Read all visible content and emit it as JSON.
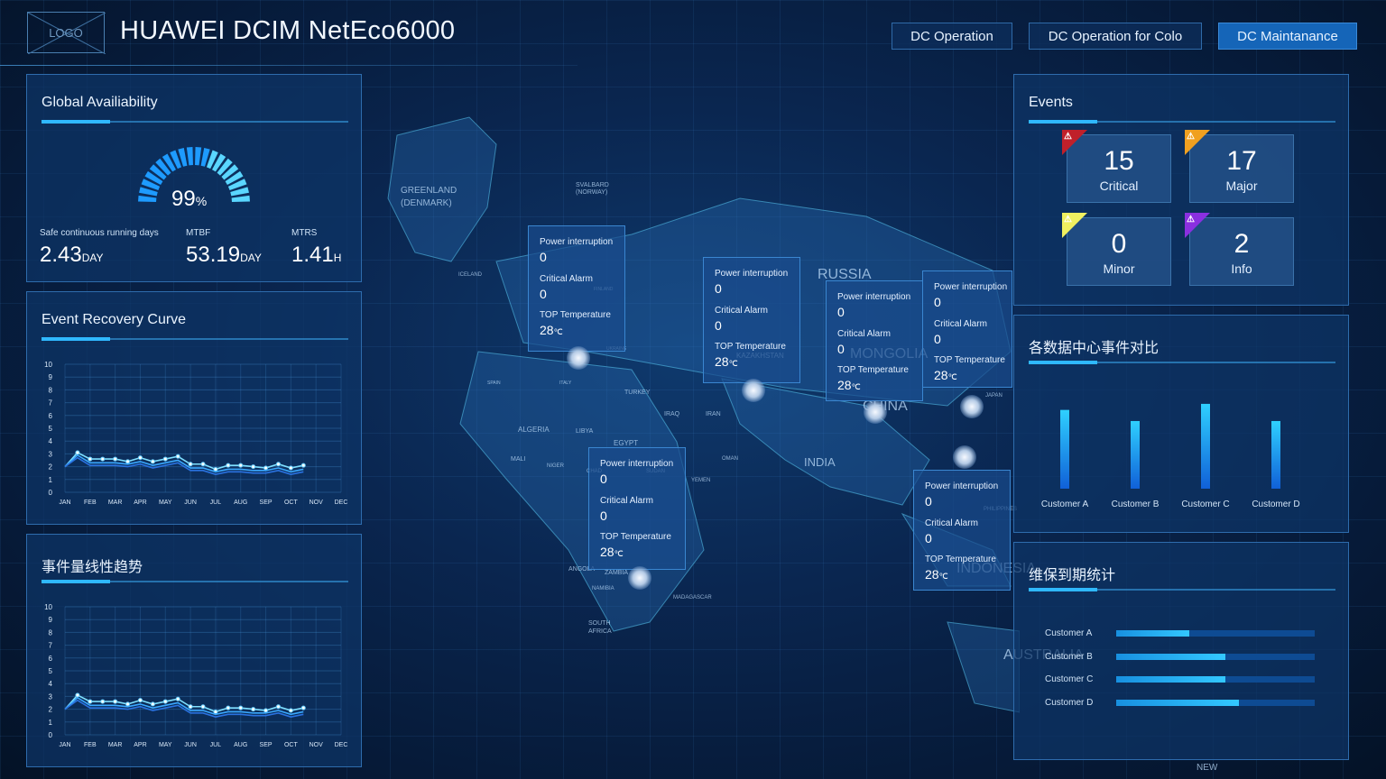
{
  "header": {
    "logo_text": "LOGO",
    "title": "HUAWEI DCIM NetEco6000",
    "nav": [
      {
        "label": "DC Operation",
        "active": false
      },
      {
        "label": "DC Operation for Colo",
        "active": false
      },
      {
        "label": "DC Maintanance",
        "active": true
      }
    ]
  },
  "availability": {
    "title": "Global Availiability",
    "gauge_value": "99",
    "gauge_unit": "%",
    "metrics": [
      {
        "label": "Safe continuous running  days",
        "value": "2.43",
        "unit": "DAY"
      },
      {
        "label": "MTBF",
        "value": "53.19",
        "unit": "DAY"
      },
      {
        "label": "MTRS",
        "value": "1.41",
        "unit": "H"
      }
    ]
  },
  "recovery_curve": {
    "title": "Event Recovery Curve"
  },
  "trend": {
    "title": "事件量线性趋势"
  },
  "events": {
    "title": "Events",
    "items": [
      {
        "count": "15",
        "label": "Critical",
        "color": "#c0202a"
      },
      {
        "count": "17",
        "label": "Major",
        "color": "#f0a020"
      },
      {
        "count": "0",
        "label": "Minor",
        "color": "#f0f060"
      },
      {
        "count": "2",
        "label": "Info",
        "color": "#8a30e0"
      }
    ]
  },
  "dc_compare": {
    "title": "各数据中心事件对比"
  },
  "maintenance": {
    "title": "维保到期统计",
    "items": [
      {
        "label": "Customer A",
        "fraction": 0.37
      },
      {
        "label": "Customer B",
        "fraction": 0.55
      },
      {
        "label": "Customer C",
        "fraction": 0.55
      },
      {
        "label": "Customer D",
        "fraction": 0.62
      }
    ]
  },
  "map": {
    "labels": [
      "GREENLAND",
      "(DENMARK)",
      "SVALBARD",
      "(NORWAY)",
      "RUSSIA",
      "MONGOLIA",
      "CHINA",
      "INDIA",
      "TURKEY",
      "IRAN",
      "IRAQ",
      "EGYPT",
      "LIBYA",
      "ALGERIA",
      "MALI",
      "NIGER",
      "CHAD",
      "SUDAN",
      "OMAN",
      "YEMEN",
      "ANGOLA",
      "ZAMBIA",
      "NAMIBIA",
      "SOUTH",
      "AFRICA",
      "MADAGASCAR",
      "KAZAKHSTAN",
      "UKRAINE",
      "SPAIN",
      "ITALY",
      "FINLAND",
      "ICELAND",
      "JAPAN",
      "PHILIPPINES",
      "INDONESIA",
      "AUSTRALIA",
      "NEW"
    ],
    "popup_labels": {
      "power": "Power interruption",
      "alarm": "Critical Alarm",
      "temp": "TOP Temperature",
      "temp_unit": "℃"
    },
    "popups": [
      {
        "power": "0",
        "alarm": "0",
        "temp": "28"
      },
      {
        "power": "0",
        "alarm": "0",
        "temp": "28"
      },
      {
        "power": "0",
        "alarm": "0",
        "temp": "28"
      },
      {
        "power": "0",
        "alarm": "0",
        "temp": "28"
      },
      {
        "power": "0",
        "alarm": "0",
        "temp": "28"
      },
      {
        "power": "0",
        "alarm": "0",
        "temp": "28"
      }
    ]
  },
  "chart_data": [
    {
      "type": "line",
      "title": "Event Recovery Curve",
      "categories": [
        "JAN",
        "FEB",
        "MAR",
        "APR",
        "MAY",
        "JUN",
        "JUL",
        "AUG",
        "SEP",
        "OCT",
        "NOV",
        "DEC"
      ],
      "x": [
        0,
        0.5,
        1,
        1.5,
        2,
        2.5,
        3,
        3.5,
        4,
        4.5,
        5,
        5.5,
        6,
        6.5,
        7,
        7.5,
        8,
        8.5,
        9,
        9.5
      ],
      "series": [
        {
          "values": [
            2.0,
            3.1,
            2.6,
            2.6,
            2.6,
            2.4,
            2.7,
            2.4,
            2.6,
            2.8,
            2.2,
            2.2,
            1.8,
            2.1,
            2.1,
            2.0,
            1.9,
            2.2,
            1.9,
            2.1
          ]
        },
        {
          "values": [
            2.0,
            2.9,
            2.3,
            2.3,
            2.3,
            2.2,
            2.4,
            2.1,
            2.3,
            2.5,
            1.9,
            1.9,
            1.6,
            1.8,
            1.8,
            1.7,
            1.7,
            1.9,
            1.6,
            1.8
          ]
        },
        {
          "values": [
            2.0,
            2.7,
            2.1,
            2.1,
            2.1,
            2.0,
            2.2,
            1.9,
            2.1,
            2.3,
            1.7,
            1.7,
            1.4,
            1.6,
            1.6,
            1.5,
            1.5,
            1.7,
            1.4,
            1.6
          ]
        }
      ],
      "yticks": [
        0,
        1,
        2,
        3,
        4,
        5,
        6,
        7,
        8,
        9,
        10
      ],
      "ylim": [
        0,
        10
      ],
      "grid": true
    },
    {
      "type": "line",
      "title": "事件量线性趋势",
      "categories": [
        "JAN",
        "FEB",
        "MAR",
        "APR",
        "MAY",
        "JUN",
        "JUL",
        "AUG",
        "SEP",
        "OCT",
        "NOV",
        "DEC"
      ],
      "x": [
        0,
        0.5,
        1,
        1.5,
        2,
        2.5,
        3,
        3.5,
        4,
        4.5,
        5,
        5.5,
        6,
        6.5,
        7,
        7.5,
        8,
        8.5,
        9,
        9.5
      ],
      "series": [
        {
          "values": [
            2.0,
            3.1,
            2.6,
            2.6,
            2.6,
            2.4,
            2.7,
            2.4,
            2.6,
            2.8,
            2.2,
            2.2,
            1.8,
            2.1,
            2.1,
            2.0,
            1.9,
            2.2,
            1.9,
            2.1
          ]
        },
        {
          "values": [
            2.0,
            2.9,
            2.3,
            2.3,
            2.3,
            2.2,
            2.4,
            2.1,
            2.3,
            2.5,
            1.9,
            1.9,
            1.6,
            1.8,
            1.8,
            1.7,
            1.7,
            1.9,
            1.6,
            1.8
          ]
        },
        {
          "values": [
            2.0,
            2.7,
            2.1,
            2.1,
            2.1,
            2.0,
            2.2,
            1.9,
            2.1,
            2.3,
            1.7,
            1.7,
            1.4,
            1.6,
            1.6,
            1.5,
            1.5,
            1.7,
            1.4,
            1.6
          ]
        }
      ],
      "yticks": [
        0,
        1,
        2,
        3,
        4,
        5,
        6,
        7,
        8,
        9,
        10
      ],
      "ylim": [
        0,
        10
      ],
      "grid": true
    },
    {
      "type": "bar",
      "title": "各数据中心事件对比",
      "categories": [
        "Customer A",
        "Customer B",
        "Customer C",
        "Customer D"
      ],
      "values": [
        0.78,
        0.67,
        0.84,
        0.67
      ],
      "ylim": [
        0,
        1
      ]
    },
    {
      "type": "bar",
      "orientation": "horizontal",
      "title": "维保到期统计",
      "categories": [
        "Customer A",
        "Customer B",
        "Customer C",
        "Customer D"
      ],
      "values": [
        0.37,
        0.55,
        0.55,
        0.62
      ],
      "xlim": [
        0,
        1
      ]
    }
  ]
}
